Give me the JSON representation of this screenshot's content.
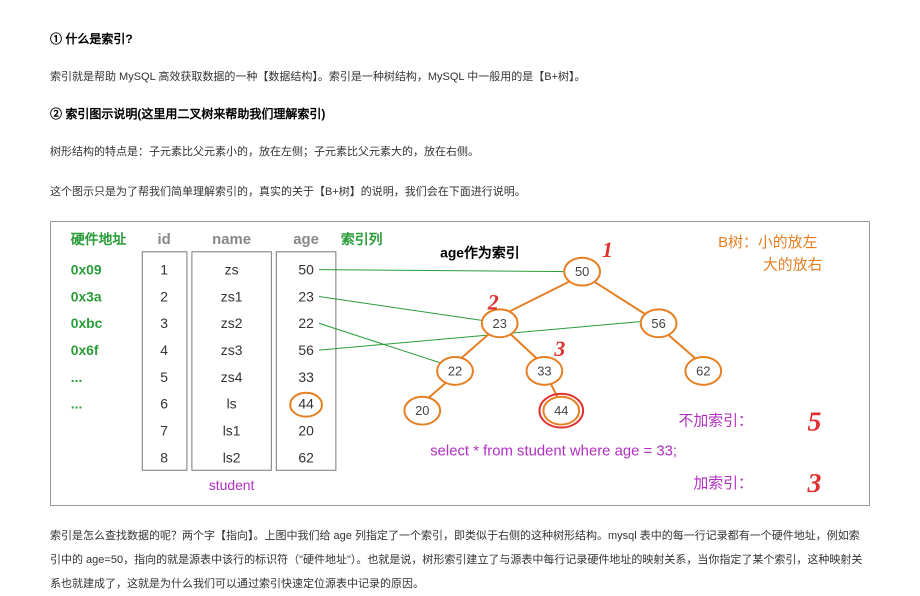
{
  "headings": {
    "h1": "① 什么是索引?",
    "h2": "② 索引图示说明(这里用二叉树来帮助我们理解索引)"
  },
  "paragraphs": {
    "p1": "索引就是帮助 MySQL 高效获取数据的一种【数据结构】。索引是一种树结构，MySQL 中一般用的是【B+树】。",
    "p2": "树形结构的特点是：子元素比父元素小的，放在左侧；子元素比父元素大的，放在右侧。",
    "p3": "这个图示只是为了帮我们简单理解索引的，真实的关于【B+树】的说明，我们会在下面进行说明。",
    "p4": "索引是怎么查找数据的呢？两个字【指向】。上图中我们给 age 列指定了一个索引，即类似于右侧的这种树形结构。mysql 表中的每一行记录都有一个硬件地址，例如索引中的 age=50，指向的就是源表中该行的标识符（\"硬件地址\"）。也就是说，树形索引建立了与源表中每行记录硬件地址的映射关系，当你指定了某个索引，这种映射关系也就建成了，这就是为什么我们可以通过索引快速定位源表中记录的原因。"
  },
  "diagram": {
    "hwLabel": "硬件地址",
    "idxLabel": "索引列",
    "ageIdxLabel": "age作为索引",
    "columns": {
      "id": "id",
      "name": "name",
      "age": "age"
    },
    "addrs": [
      "0x09",
      "0x3a",
      "0xbc",
      "0x6f",
      "...",
      "..."
    ],
    "rows": [
      {
        "id": "1",
        "name": "zs",
        "age": "50"
      },
      {
        "id": "2",
        "name": "zs1",
        "age": "23"
      },
      {
        "id": "3",
        "name": "zs2",
        "age": "22"
      },
      {
        "id": "4",
        "name": "zs3",
        "age": "56"
      },
      {
        "id": "5",
        "name": "zs4",
        "age": "33"
      },
      {
        "id": "6",
        "name": "ls",
        "age": "44"
      },
      {
        "id": "7",
        "name": "ls1",
        "age": "20"
      },
      {
        "id": "8",
        "name": "ls2",
        "age": "62"
      }
    ],
    "tableName": "student",
    "btreeNote1": "B树：小的放左",
    "btreeNote2": "大的放右",
    "tree": {
      "n50": "50",
      "n23": "23",
      "n56": "56",
      "n22": "22",
      "n33": "33",
      "n62": "62",
      "n20": "20",
      "n44": "44"
    },
    "redNums": {
      "r1": "1",
      "r2": "2",
      "r3": "3"
    },
    "query": "select * from student where age = 33;",
    "noIdxLabel": "不加索引：",
    "noIdxVal": "5",
    "withIdxLabel": "加索引：",
    "withIdxVal": "3"
  }
}
